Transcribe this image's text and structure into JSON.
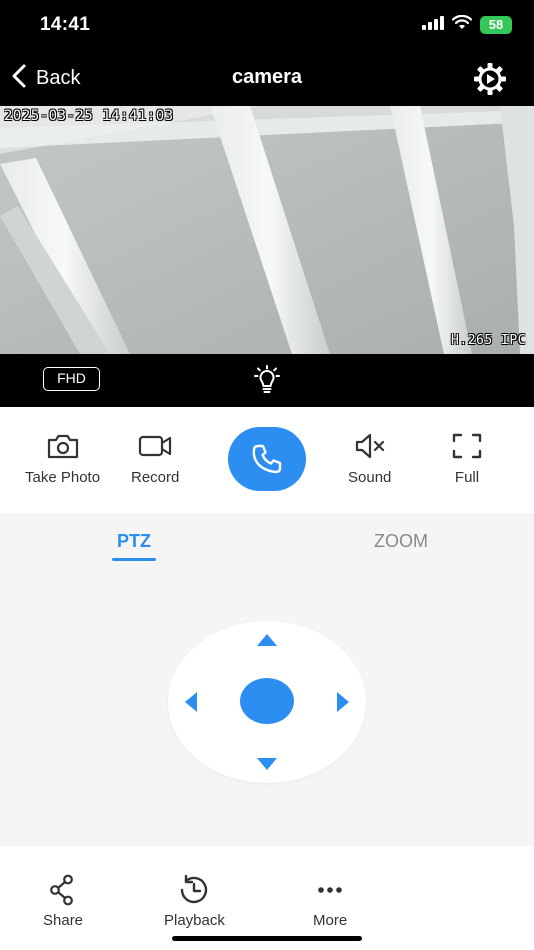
{
  "status_bar": {
    "time": "14:41",
    "battery": "58"
  },
  "nav": {
    "back_label": "Back",
    "title": "camera"
  },
  "video": {
    "timestamp": "2025-03-25 14:41:03",
    "codec": "H.265 IPC"
  },
  "strip": {
    "quality": "FHD"
  },
  "actions": {
    "take_photo": "Take Photo",
    "record": "Record",
    "sound": "Sound",
    "full": "Full"
  },
  "tabs": {
    "ptz": "PTZ",
    "zoom": "ZOOM"
  },
  "bottom": {
    "share": "Share",
    "playback": "Playback",
    "more": "More"
  },
  "colors": {
    "accent": "#2b8ef0",
    "battery": "#34c759"
  }
}
